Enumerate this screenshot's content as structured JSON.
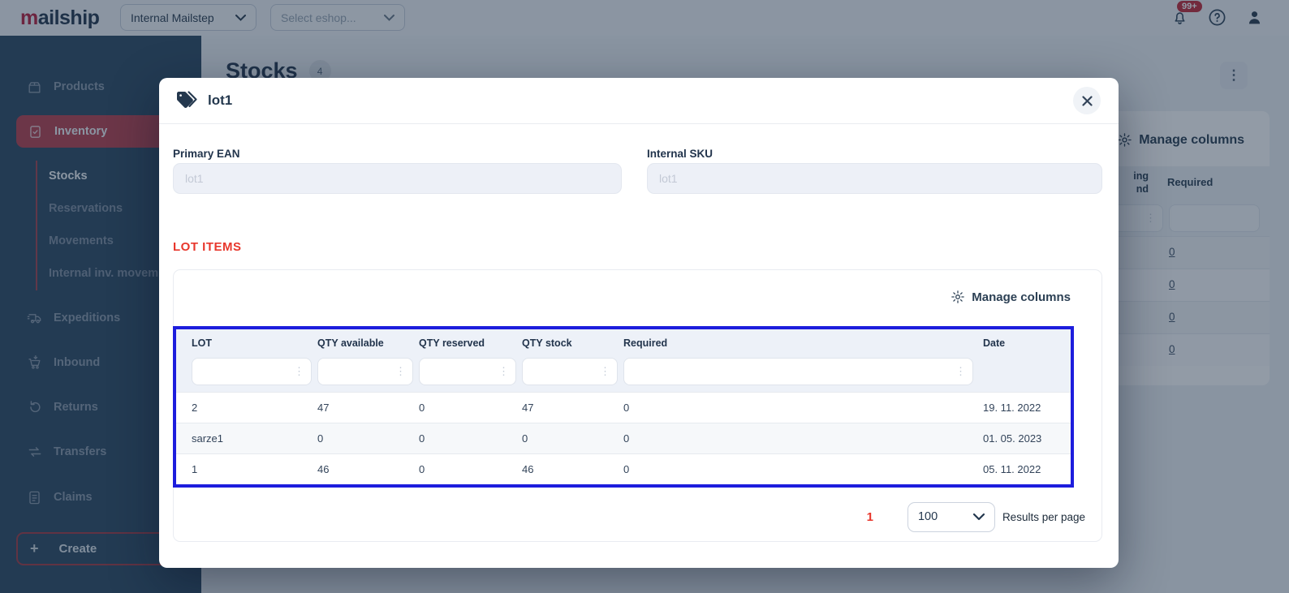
{
  "colors": {
    "brand_red": "#b81f3d",
    "accent_red": "#e8372c",
    "navy": "#24384e",
    "highlight_blue": "#1d1ddd",
    "sidebar_bg": "#2e4a63"
  },
  "topbar": {
    "logo_prefix": "m",
    "logo_rest": "ailship",
    "org_select": "Internal Mailstep",
    "eshop_select": "Select eshop...",
    "notifications_badge": "99+"
  },
  "sidebar": {
    "items": [
      {
        "label": "Products"
      },
      {
        "label": "Inventory"
      },
      {
        "label": "Stocks"
      },
      {
        "label": "Reservations"
      },
      {
        "label": "Movements"
      },
      {
        "label": "Internal inv. movem"
      },
      {
        "label": "Expeditions"
      },
      {
        "label": "Inbound"
      },
      {
        "label": "Returns"
      },
      {
        "label": "Transfers"
      },
      {
        "label": "Claims"
      }
    ],
    "create_label": "Create"
  },
  "page": {
    "title": "Stocks",
    "badge": "4",
    "kebab": "⋮",
    "manage_columns_label": "Manage columns",
    "truncated_column_line1": "ing",
    "truncated_column_line2": "nd",
    "required_column": "Required",
    "filter_dots": "⋮",
    "rows": [
      {
        "required": "0"
      },
      {
        "required": "0"
      },
      {
        "required": "0"
      },
      {
        "required": "0"
      }
    ]
  },
  "modal": {
    "title": "lot1",
    "primary_ean_label": "Primary EAN",
    "primary_ean_placeholder": "lot1",
    "internal_sku_label": "Internal SKU",
    "internal_sku_placeholder": "lot1",
    "section_title": "LOT ITEMS",
    "manage_columns_label": "Manage columns",
    "filter_dots": "⋮",
    "table": {
      "columns": [
        "LOT",
        "QTY available",
        "QTY reserved",
        "QTY stock",
        "Required",
        "Date"
      ],
      "rows": [
        {
          "lot": "2",
          "qty_available": "47",
          "qty_reserved": "0",
          "qty_stock": "47",
          "required": "0",
          "date": "19. 11. 2022"
        },
        {
          "lot": "sarze1",
          "qty_available": "0",
          "qty_reserved": "0",
          "qty_stock": "0",
          "required": "0",
          "date": "01. 05. 2023"
        },
        {
          "lot": "1",
          "qty_available": "46",
          "qty_reserved": "0",
          "qty_stock": "46",
          "required": "0",
          "date": "05. 11. 2022"
        }
      ]
    },
    "pagination": {
      "current_page": "1",
      "page_size": "100",
      "results_per_page_label": "Results per page"
    }
  }
}
